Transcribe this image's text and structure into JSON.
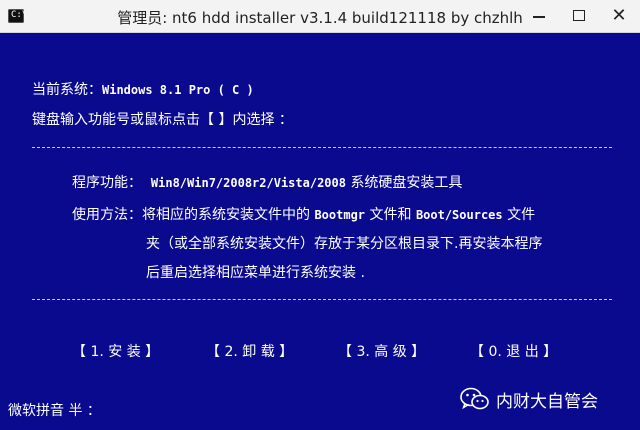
{
  "window": {
    "title": "管理员:  nt6 hdd installer v3.1.4 build121118 by chzhlh",
    "icon": "cmd-icon",
    "controls": [
      "minimize-icon",
      "maximize-icon",
      "close-icon"
    ],
    "close_glyph": "✕"
  },
  "colors": {
    "console_bg": "#0a0a8f",
    "text": "#ffffff",
    "titlebar_bg": "#f3f3f3"
  },
  "console": {
    "current_system_label": "当前系统：",
    "current_system_value": "Windows 8.1 Pro  ( C )",
    "prompt": "键盘输入功能号或鼠标点击【 】内选择 ：",
    "function_label": "程序功能：",
    "function_value_os": "Win8/Win7/2008r2/Vista/2008",
    "function_value_tail": "系统硬盘安装工具",
    "usage_label": "使用方法：",
    "usage_line1_a": "将相应的系统安装文件中的",
    "usage_line1_b": "Bootmgr",
    "usage_line1_c": "文件和",
    "usage_line1_d": "Boot/Sources",
    "usage_line1_e": "文件",
    "usage_line2": "夹（或全部系统安装文件）存放于某分区根目录下.再安装本程序",
    "usage_line3": "后重启选择相应菜单进行系统安装 ."
  },
  "menu": [
    {
      "label": "【 1. 安 装 】"
    },
    {
      "label": "【 2. 卸 载 】"
    },
    {
      "label": "【 3. 高 级 】"
    },
    {
      "label": "【 0. 退 出 】"
    }
  ],
  "status": {
    "ime_text": "微软拼音 半 ："
  },
  "watermark": {
    "icon": "wechat-icon",
    "text": "内财大自管会"
  }
}
